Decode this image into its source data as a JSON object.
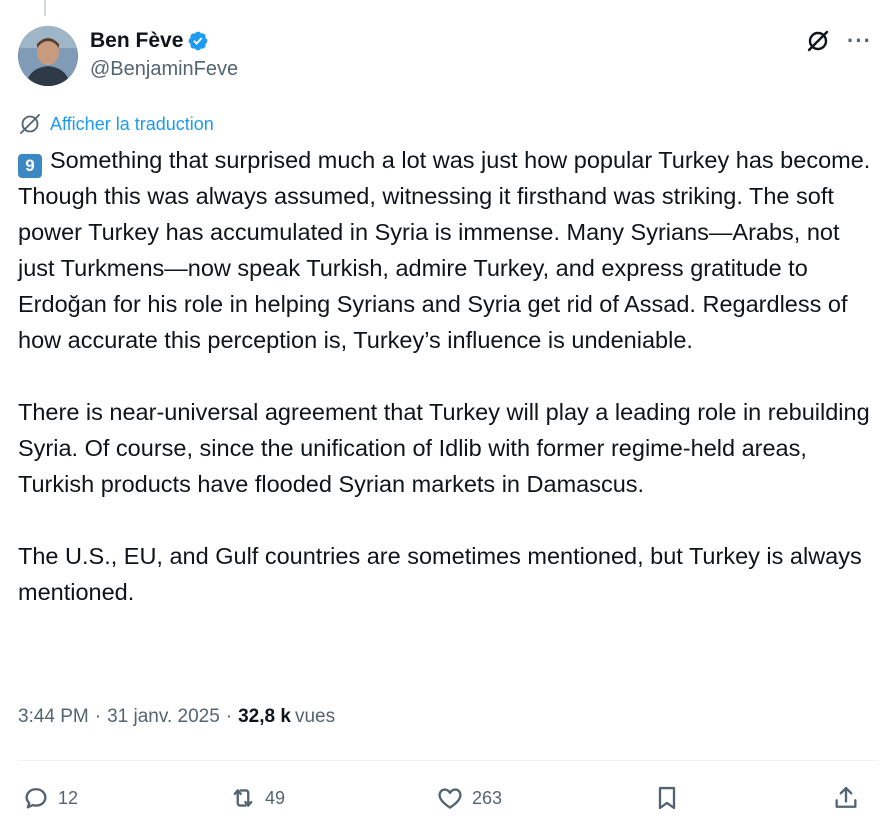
{
  "author": {
    "display_name": "Ben Fève",
    "handle": "@BenjaminFeve",
    "verified": true
  },
  "translate_label": "Afficher la traduction",
  "tweet": {
    "keycap": "9",
    "paragraphs": [
      "Something that surprised much a lot was just how popular Turkey has become. Though this was always assumed, witnessing it firsthand was striking. The soft power Turkey has accumulated in Syria is immense. Many Syrians—Arabs, not just Turkmens—now speak Turkish, admire Turkey, and express gratitude to Erdoğan for his role in helping Syrians and Syria get rid of Assad. Regardless of how accurate this perception is, Turkey’s influence is undeniable.",
      "There is near-universal agreement that Turkey will play a leading role in rebuilding Syria. Of course, since the unification of Idlib with former regime-held areas, Turkish products have flooded Syrian markets in Damascus.",
      "The U.S., EU, and Gulf countries are sometimes mentioned, but Turkey is always mentioned."
    ]
  },
  "meta": {
    "time": "3:44 PM",
    "separator": "·",
    "date": "31 janv. 2025",
    "views_count": "32,8 k",
    "views_label": "vues"
  },
  "actions": {
    "replies": "12",
    "reposts": "49",
    "likes": "263"
  },
  "colors": {
    "accent": "#1d9bf0",
    "secondary_text": "#536471",
    "primary_text": "#0f1419",
    "keycap": "#3b88c3"
  },
  "icons": [
    "verified-badge-icon",
    "grok-icon",
    "more-icon",
    "translate-icon",
    "reply-icon",
    "repost-icon",
    "like-icon",
    "bookmark-icon",
    "share-icon"
  ]
}
